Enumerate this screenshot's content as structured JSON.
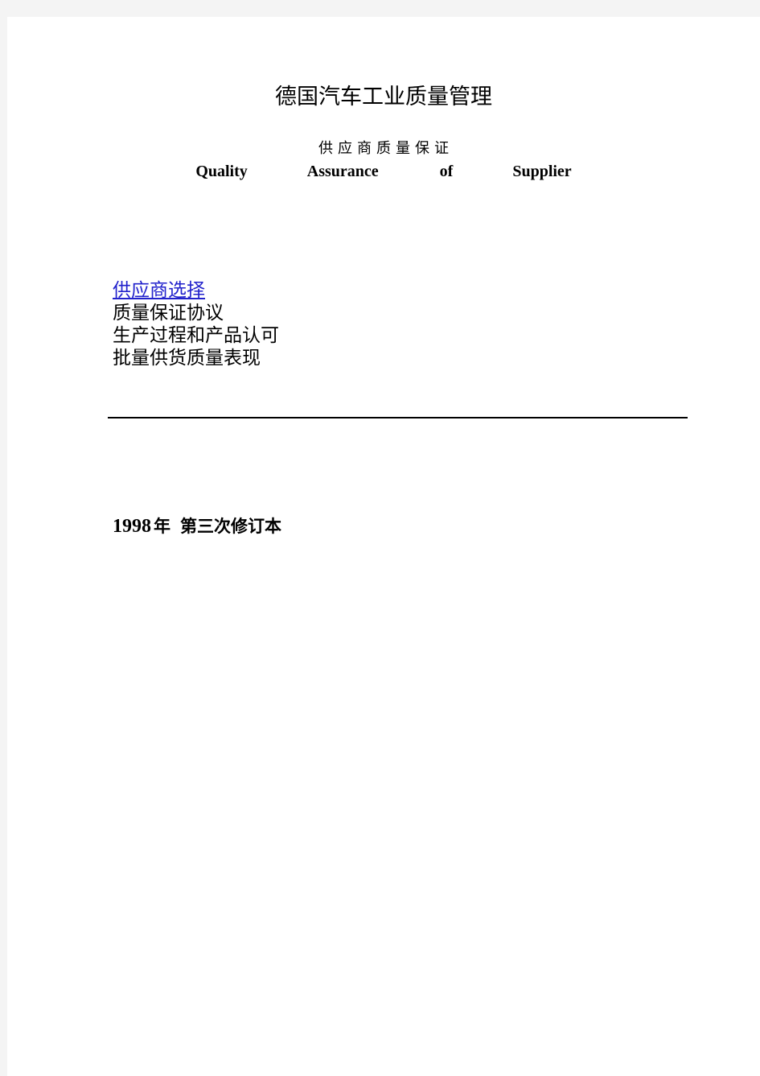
{
  "document": {
    "title": "德国汽车工业质量管理",
    "subtitle_cn": "供应商质量保证",
    "subtitle_en": {
      "word1": "Quality",
      "word2": "Assurance",
      "word3": "of",
      "word4": "Supplier"
    },
    "contents": [
      {
        "label": "供应商选择",
        "is_link": true
      },
      {
        "label": "质量保证协议",
        "is_link": false
      },
      {
        "label": "生产过程和产品认可",
        "is_link": false
      },
      {
        "label": "批量供货质量表现",
        "is_link": false
      }
    ],
    "edition": {
      "year": "1998",
      "year_unit": "年",
      "revision": "第三次修订本"
    }
  },
  "colors": {
    "link": "#2222cc",
    "text": "#000000",
    "page": "#ffffff",
    "gutter": "#f4f4f4",
    "rule": "#000000"
  }
}
